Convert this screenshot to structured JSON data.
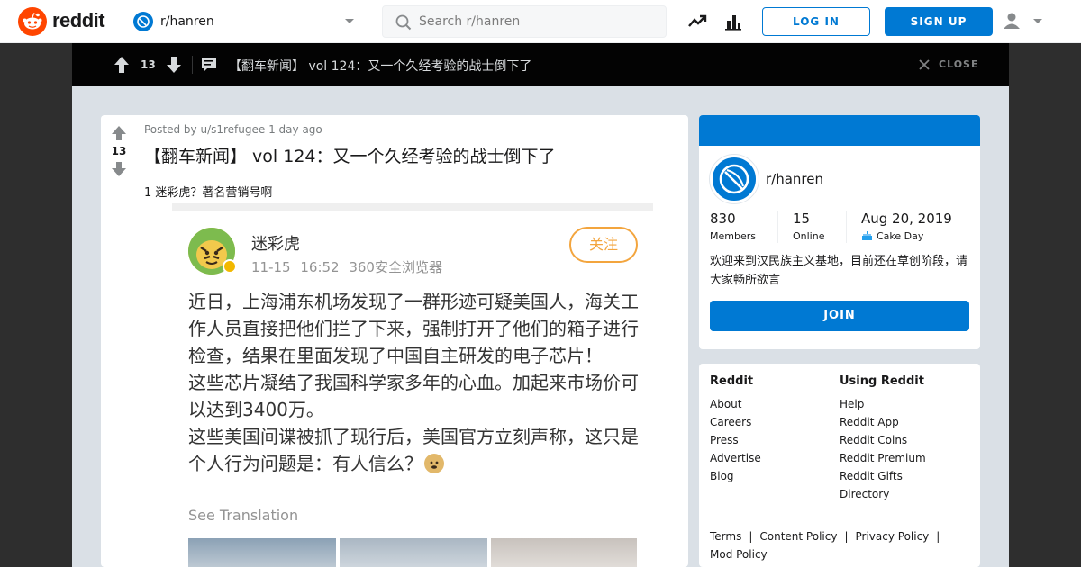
{
  "header": {
    "brand": "reddit",
    "community": "r/hanren",
    "search_placeholder": "Search r/hanren",
    "login_label": "LOG IN",
    "signup_label": "SIGN UP"
  },
  "post_bar": {
    "votes": "13",
    "title": "【翻车新闻】 vol 124：又一个久经考验的战士倒下了",
    "close_label": "CLOSE"
  },
  "post": {
    "posted_by_prefix": "Posted by",
    "author": "u/s1refugee",
    "time": "1 day ago",
    "votes": "13",
    "title": "【翻车新闻】 vol 124：又一个久经考验的战士倒下了",
    "subtitle": "1 迷彩虎？著名营销号啊"
  },
  "embed": {
    "name": "迷彩虎",
    "meta": "11-15 16:52 360安全浏览器",
    "follow_label": "关注",
    "body_lines": [
      "近日，上海浦东机场发现了一群形迹可疑美国人，海关工作人员直接把他们拦了下来，强制打开了他们的箱子进行检查，结果在里面发现了中国自主研发的电子芯片！",
      "这些芯片凝结了我国科学家多年的心血。加起来市场价可以达到3400万。",
      "这些美国间谍被抓了现行后，美国官方立刻声称，这只是个人行为问题是：有人信么？"
    ],
    "see_translation": "See Translation"
  },
  "about": {
    "name": "r/hanren",
    "members_count": "830",
    "members_label": "Members",
    "online_count": "15",
    "online_label": "Online",
    "cake_date": "Aug 20, 2019",
    "cake_label": "Cake Day",
    "description": "欢迎来到汉民族主义基地，目前还在草创阶段，请大家畅所欲言",
    "join_label": "JOIN"
  },
  "links": {
    "col1_title": "Reddit",
    "col1": [
      "About",
      "Careers",
      "Press",
      "Advertise",
      "Blog"
    ],
    "col2_title": "Using Reddit",
    "col2": [
      "Help",
      "Reddit App",
      "Reddit Coins",
      "Reddit Premium",
      "Reddit Gifts",
      "Directory"
    ],
    "footer": [
      "Terms",
      "Content Policy",
      "Privacy Policy",
      "Mod Policy"
    ]
  },
  "colors": {
    "brand_orange": "#ff4500",
    "accent_blue": "#0079d3",
    "follow_orange": "#f3a53e"
  }
}
